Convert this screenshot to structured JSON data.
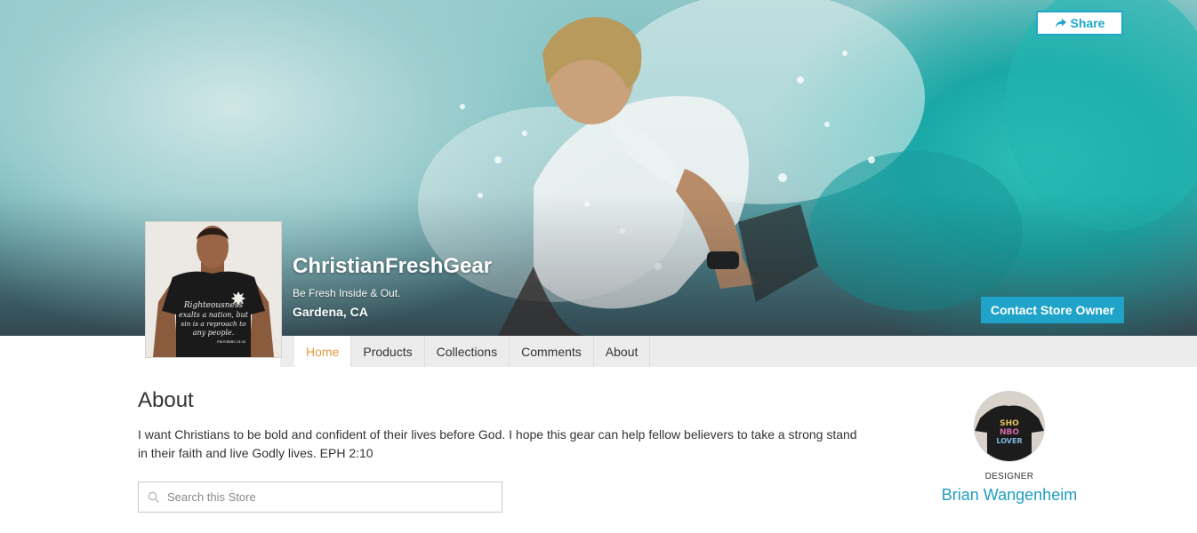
{
  "header": {
    "share_label": "Share",
    "store_name": "ChristianFreshGear",
    "tagline": "Be Fresh Inside & Out.",
    "location": "Gardena, CA",
    "contact_label": "Contact Store Owner"
  },
  "avatar_shirt": {
    "text": [
      "Righteousness",
      "exalts a nation, but",
      "sin is a reproach to",
      "any people."
    ],
    "ref": "PROVERBS 14:34"
  },
  "nav": {
    "tabs": [
      {
        "label": "Home",
        "active": true
      },
      {
        "label": "Products",
        "active": false
      },
      {
        "label": "Collections",
        "active": false
      },
      {
        "label": "Comments",
        "active": false
      },
      {
        "label": "About",
        "active": false
      }
    ]
  },
  "about": {
    "heading": "About",
    "body": "I want Christians to be bold and confident of their lives before God. I hope this gear can help fellow believers to take a strong stand in their faith and live Godly lives. EPH 2:10"
  },
  "search": {
    "placeholder": "Search this Store"
  },
  "designer": {
    "label": "DESIGNER",
    "name": "Brian Wangenheim",
    "shirt_text": [
      "SHO",
      "NBO",
      "LOVER"
    ]
  },
  "colors": {
    "accent": "#1fa3c8",
    "active_tab": "#e09a3e",
    "designer_link": "#1f9ec1"
  }
}
